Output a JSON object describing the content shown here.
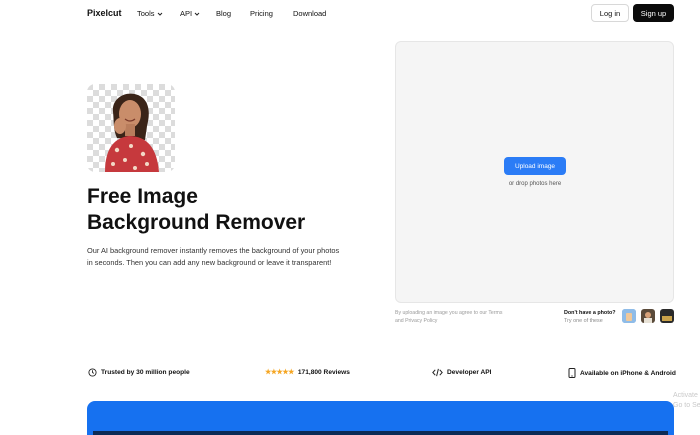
{
  "header": {
    "logo": "Pixelcut",
    "nav": [
      {
        "label": "Tools",
        "has_dropdown": true
      },
      {
        "label": "API",
        "has_dropdown": true
      },
      {
        "label": "Blog",
        "has_dropdown": false
      },
      {
        "label": "Pricing",
        "has_dropdown": false
      },
      {
        "label": "Download",
        "has_dropdown": false
      }
    ],
    "login_label": "Log in",
    "signup_label": "Sign up"
  },
  "hero": {
    "title_line1": "Free Image",
    "title_line2": "Background Remover",
    "description": "Our AI background remover instantly removes the background of your photos in seconds. Then you can add any new background or leave it transparent!"
  },
  "upload": {
    "button_label": "Upload image",
    "hint": "or drop photos here",
    "terms": "By uploading an image you agree to our Terms and Privacy Policy",
    "no_photo_title": "Don't have a photo?",
    "no_photo_sub": "Try one of these"
  },
  "stats": [
    {
      "icon": "trusted-icon",
      "label": "Trusted by 30 million people"
    },
    {
      "icon": "stars-icon",
      "stars": "★★★★★",
      "label": "171,800 Reviews"
    },
    {
      "icon": "code-icon",
      "label": "Developer API"
    },
    {
      "icon": "phone-icon",
      "label": "Available on iPhone & Android"
    }
  ],
  "overlay": {
    "line1": "Activate",
    "line2": "Go to Se"
  },
  "colors": {
    "primary": "#2b7cf6",
    "banner": "#1671f0",
    "dark": "#0b0b0b",
    "star": "#f5a623"
  }
}
